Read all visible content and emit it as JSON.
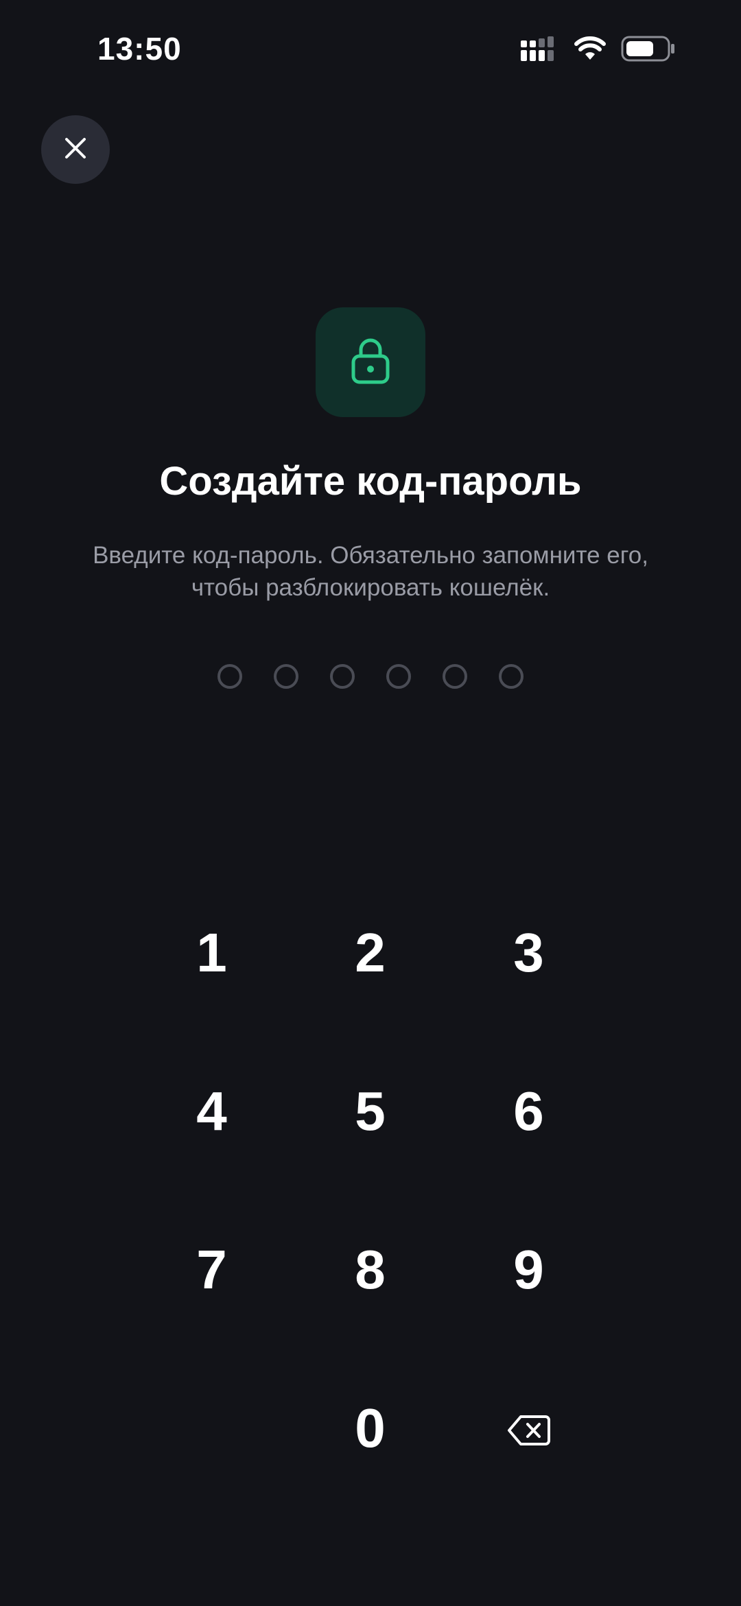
{
  "status_bar": {
    "time": "13:50",
    "icons": [
      "signal-icon",
      "wifi-icon",
      "battery-icon"
    ],
    "battery_level_percent": 70
  },
  "header": {
    "close_icon": "close-icon"
  },
  "hero": {
    "icon": "lock-icon",
    "accent_color": "#2ecc8a",
    "badge_color": "#10302a"
  },
  "title": "Создайте код-пароль",
  "subtitle_line1": "Введите код-пароль. Обязательно запомните его,",
  "subtitle_line2": "чтобы разблокировать кошелёк.",
  "passcode": {
    "length": 6,
    "filled": 0
  },
  "keypad": {
    "keys": [
      "1",
      "2",
      "3",
      "4",
      "5",
      "6",
      "7",
      "8",
      "9",
      "",
      "0"
    ],
    "backspace_icon": "backspace-icon"
  },
  "colors": {
    "background": "#121318",
    "text_primary": "#ffffff",
    "text_secondary": "#9a9ca6",
    "accent": "#2ecc8a"
  }
}
